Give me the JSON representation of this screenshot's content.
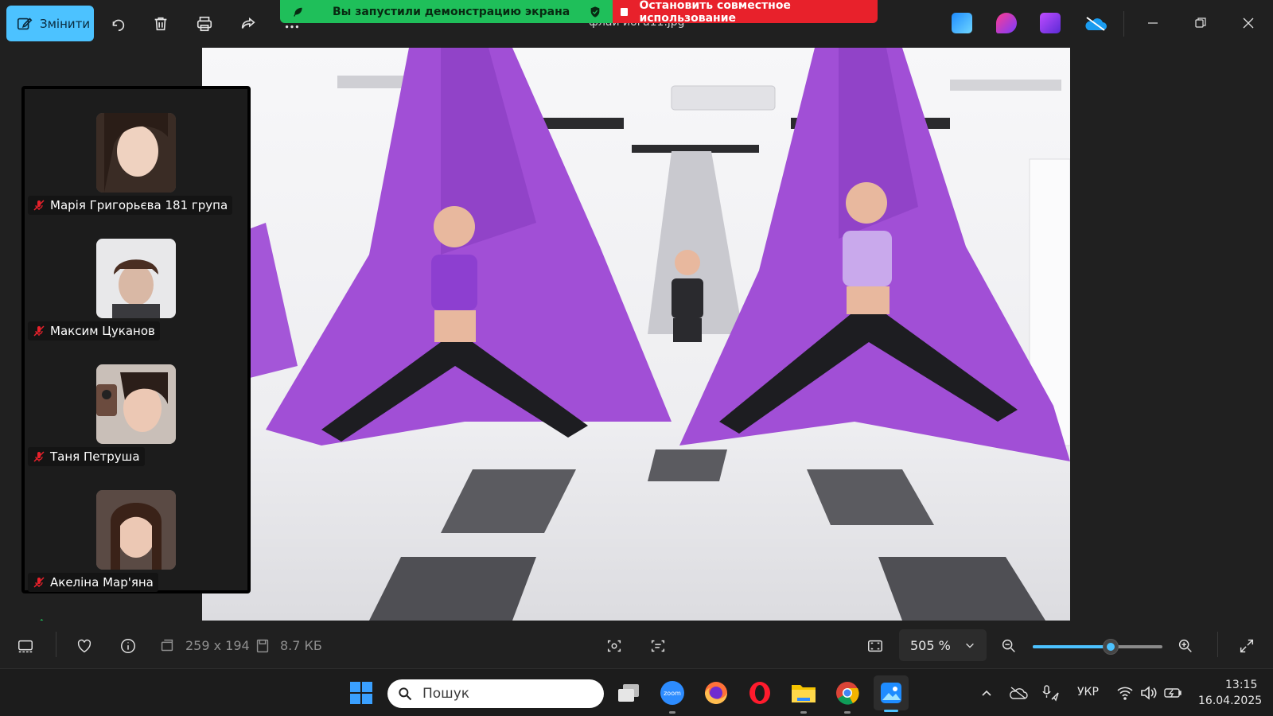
{
  "window": {
    "file_name": "флай йога11.jpg",
    "edit_label": "Змінити"
  },
  "share": {
    "notice": "Вы запустили демонстрацию экрана",
    "stop_label": "Остановить совместное использование"
  },
  "participants": [
    {
      "name": "Марія Григорьєва 181 група",
      "muted": true
    },
    {
      "name": "Максим Цуканов",
      "muted": true
    },
    {
      "name": "Таня Петруша",
      "muted": true
    },
    {
      "name": "Акеліна Мар'яна",
      "muted": true
    }
  ],
  "image_info": {
    "dimensions": "259 x 194",
    "file_size": "8.7 КБ"
  },
  "zoom": {
    "level_label": "505 %",
    "slider_fraction": 0.6
  },
  "taskbar": {
    "search_placeholder": "Пошук",
    "language": "УКР",
    "time": "13:15",
    "date": "16.04.2025"
  },
  "colors": {
    "accent": "#4cc2ff",
    "share_green": "#1fbf5a",
    "share_red": "#e8212b",
    "hammock_purple": "#a14fd6"
  }
}
